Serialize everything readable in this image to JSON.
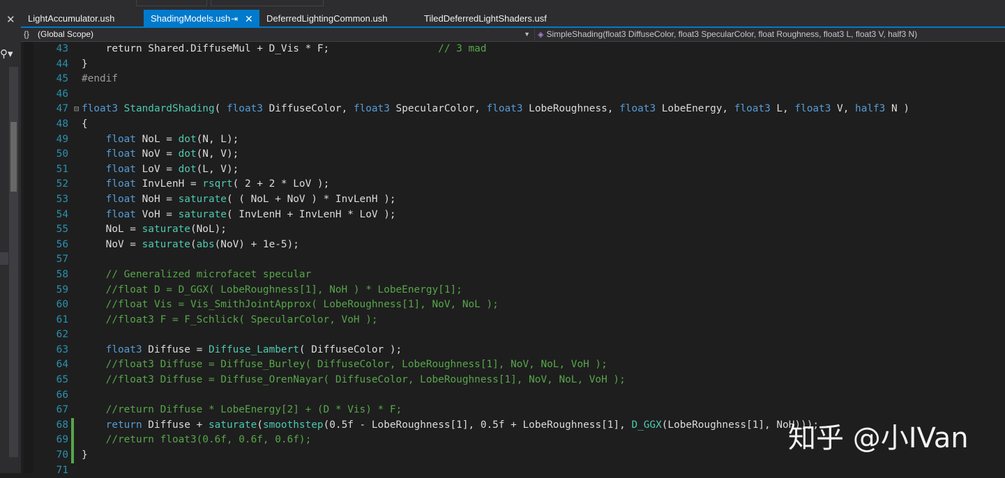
{
  "tabs": [
    {
      "label": "LightAccumulator.ush",
      "active": false
    },
    {
      "label": "ShadingModels.ush",
      "active": true,
      "pin": "⇥",
      "close": "✕"
    },
    {
      "label": "DeferredLightingCommon.ush",
      "active": false
    },
    {
      "label": "TiledDeferredLightShaders.usf",
      "active": false
    }
  ],
  "navbar": {
    "scope_icon": "{}",
    "scope": "(Global Scope)",
    "member_icon": "cube-icon",
    "member": "SimpleShading(float3 DiffuseColor, float3 SpecularColor, float Roughness, float3 L, float3 V, half3 N)"
  },
  "colors": {
    "accent": "#007acc",
    "keyword": "#569cd6",
    "function": "#4ec9b0",
    "comment": "#57a64a",
    "line_number": "#2b91af",
    "text": "#dcdcdc",
    "background": "#1e1e1e"
  },
  "code": [
    {
      "n": "43",
      "segs": [
        [
          "tx",
          "    return Shared.DiffuseMul + D_Vis * F;                  "
        ],
        [
          "cm",
          "// 3 mad"
        ]
      ]
    },
    {
      "n": "44",
      "segs": [
        [
          "tx",
          "}"
        ]
      ]
    },
    {
      "n": "45",
      "segs": [
        [
          "pp",
          "#endif"
        ]
      ]
    },
    {
      "n": "46",
      "segs": []
    },
    {
      "n": "47",
      "fold": "⊟",
      "segs": [
        [
          "kw",
          "float3"
        ],
        [
          "tx",
          " "
        ],
        [
          "fn",
          "StandardShading"
        ],
        [
          "tx",
          "( "
        ],
        [
          "kw",
          "float3"
        ],
        [
          "tx",
          " DiffuseColor, "
        ],
        [
          "kw",
          "float3"
        ],
        [
          "tx",
          " SpecularColor, "
        ],
        [
          "kw",
          "float3"
        ],
        [
          "tx",
          " LobeRoughness, "
        ],
        [
          "kw",
          "float3"
        ],
        [
          "tx",
          " LobeEnergy, "
        ],
        [
          "kw",
          "float3"
        ],
        [
          "tx",
          " L, "
        ],
        [
          "kw",
          "float3"
        ],
        [
          "tx",
          " V, "
        ],
        [
          "kw",
          "half3"
        ],
        [
          "tx",
          " N )"
        ]
      ]
    },
    {
      "n": "48",
      "segs": [
        [
          "tx",
          "{"
        ]
      ]
    },
    {
      "n": "49",
      "segs": [
        [
          "tx",
          "    "
        ],
        [
          "kw",
          "float"
        ],
        [
          "tx",
          " NoL = "
        ],
        [
          "fn",
          "dot"
        ],
        [
          "tx",
          "(N, L);"
        ]
      ]
    },
    {
      "n": "50",
      "segs": [
        [
          "tx",
          "    "
        ],
        [
          "kw",
          "float"
        ],
        [
          "tx",
          " NoV = "
        ],
        [
          "fn",
          "dot"
        ],
        [
          "tx",
          "(N, V);"
        ]
      ]
    },
    {
      "n": "51",
      "segs": [
        [
          "tx",
          "    "
        ],
        [
          "kw",
          "float"
        ],
        [
          "tx",
          " LoV = "
        ],
        [
          "fn",
          "dot"
        ],
        [
          "tx",
          "(L, V);"
        ]
      ]
    },
    {
      "n": "52",
      "segs": [
        [
          "tx",
          "    "
        ],
        [
          "kw",
          "float"
        ],
        [
          "tx",
          " InvLenH = "
        ],
        [
          "fn",
          "rsqrt"
        ],
        [
          "tx",
          "( 2 + 2 * LoV );"
        ]
      ]
    },
    {
      "n": "53",
      "segs": [
        [
          "tx",
          "    "
        ],
        [
          "kw",
          "float"
        ],
        [
          "tx",
          " NoH = "
        ],
        [
          "fn",
          "saturate"
        ],
        [
          "tx",
          "( ( NoL + NoV ) * InvLenH );"
        ]
      ]
    },
    {
      "n": "54",
      "segs": [
        [
          "tx",
          "    "
        ],
        [
          "kw",
          "float"
        ],
        [
          "tx",
          " VoH = "
        ],
        [
          "fn",
          "saturate"
        ],
        [
          "tx",
          "( InvLenH + InvLenH * LoV );"
        ]
      ]
    },
    {
      "n": "55",
      "segs": [
        [
          "tx",
          "    NoL = "
        ],
        [
          "fn",
          "saturate"
        ],
        [
          "tx",
          "(NoL);"
        ]
      ]
    },
    {
      "n": "56",
      "segs": [
        [
          "tx",
          "    NoV = "
        ],
        [
          "fn",
          "saturate"
        ],
        [
          "tx",
          "("
        ],
        [
          "fn",
          "abs"
        ],
        [
          "tx",
          "(NoV) + 1e-5);"
        ]
      ]
    },
    {
      "n": "57",
      "segs": []
    },
    {
      "n": "58",
      "segs": [
        [
          "tx",
          "    "
        ],
        [
          "cm",
          "// Generalized microfacet specular"
        ]
      ]
    },
    {
      "n": "59",
      "segs": [
        [
          "tx",
          "    "
        ],
        [
          "cm",
          "//float D = D_GGX( LobeRoughness[1], NoH ) * LobeEnergy[1];"
        ]
      ]
    },
    {
      "n": "60",
      "segs": [
        [
          "tx",
          "    "
        ],
        [
          "cm",
          "//float Vis = Vis_SmithJointApprox( LobeRoughness[1], NoV, NoL );"
        ]
      ]
    },
    {
      "n": "61",
      "segs": [
        [
          "tx",
          "    "
        ],
        [
          "cm",
          "//float3 F = F_Schlick( SpecularColor, VoH );"
        ]
      ]
    },
    {
      "n": "62",
      "segs": []
    },
    {
      "n": "63",
      "segs": [
        [
          "tx",
          "    "
        ],
        [
          "kw",
          "float3"
        ],
        [
          "tx",
          " Diffuse = "
        ],
        [
          "fn",
          "Diffuse_Lambert"
        ],
        [
          "tx",
          "( DiffuseColor );"
        ]
      ]
    },
    {
      "n": "64",
      "segs": [
        [
          "tx",
          "    "
        ],
        [
          "cm",
          "//float3 Diffuse = Diffuse_Burley( DiffuseColor, LobeRoughness[1], NoV, NoL, VoH );"
        ]
      ]
    },
    {
      "n": "65",
      "segs": [
        [
          "tx",
          "    "
        ],
        [
          "cm",
          "//float3 Diffuse = Diffuse_OrenNayar( DiffuseColor, LobeRoughness[1], NoV, NoL, VoH );"
        ]
      ]
    },
    {
      "n": "66",
      "segs": []
    },
    {
      "n": "67",
      "segs": [
        [
          "tx",
          "    "
        ],
        [
          "cm",
          "//return Diffuse * LobeEnergy[2] + (D * Vis) * F;"
        ]
      ]
    },
    {
      "n": "68",
      "chg": true,
      "segs": [
        [
          "tx",
          "    "
        ],
        [
          "kw",
          "return"
        ],
        [
          "tx",
          " Diffuse + "
        ],
        [
          "fn",
          "saturate"
        ],
        [
          "tx",
          "("
        ],
        [
          "fn",
          "smoothstep"
        ],
        [
          "tx",
          "(0.5f - LobeRoughness[1], 0.5f + LobeRoughness[1], "
        ],
        [
          "fn",
          "D_GGX"
        ],
        [
          "tx",
          "(LobeRoughness[1], NoH)));"
        ]
      ]
    },
    {
      "n": "69",
      "chg": true,
      "segs": [
        [
          "tx",
          "    "
        ],
        [
          "cm",
          "//return float3(0.6f, 0.6f, 0.6f);"
        ]
      ]
    },
    {
      "n": "70",
      "chg": true,
      "segs": [
        [
          "tx",
          "}"
        ]
      ]
    },
    {
      "n": "71",
      "segs": []
    }
  ],
  "watermark": "知乎 @小IVan"
}
